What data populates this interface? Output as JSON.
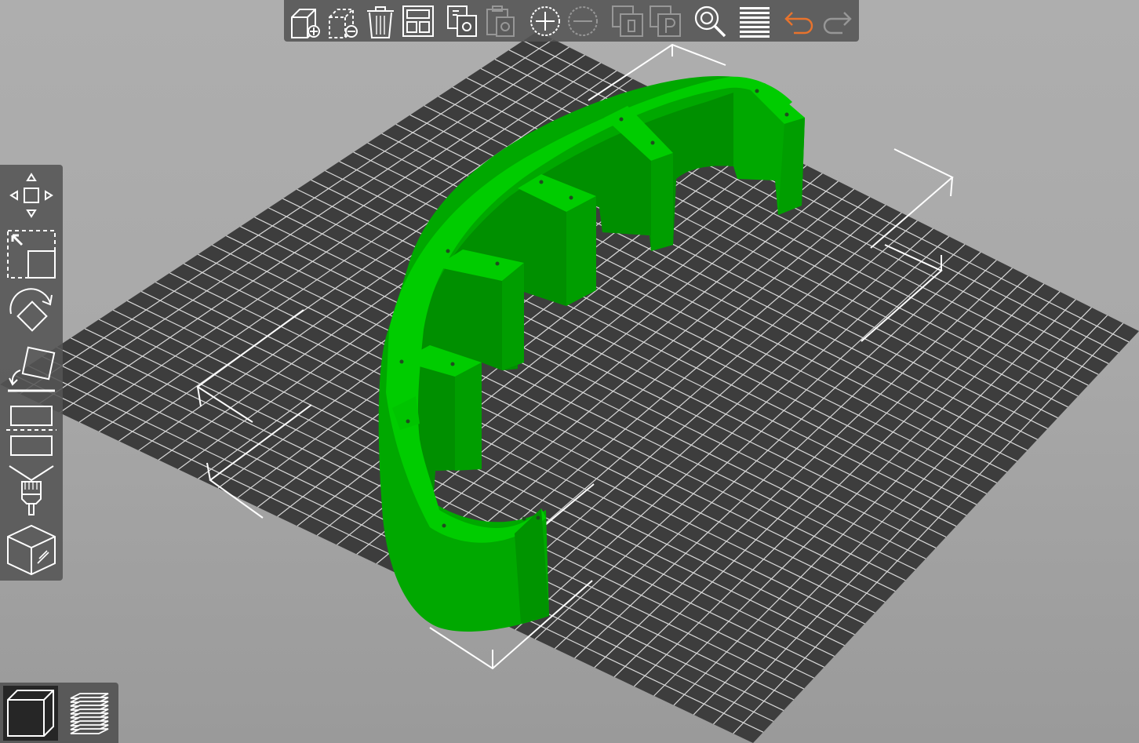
{
  "app": {
    "window": "3D plater view"
  },
  "colors": {
    "model_green": "#00c400",
    "model_green_dark": "#009a00",
    "bed_dark": "#3d3d3d",
    "grid_line": "#d8d8d8",
    "toolbar_bg": "#545454",
    "icon_white": "#ffffff",
    "undo_orange": "#e8732d"
  },
  "top_toolbar": {
    "buttons": [
      {
        "id": "add",
        "icon": "add-object-icon",
        "enabled": true
      },
      {
        "id": "delete",
        "icon": "delete-object-icon",
        "enabled": true
      },
      {
        "id": "delete-all",
        "icon": "delete-all-icon",
        "enabled": true
      },
      {
        "id": "arrange",
        "icon": "arrange-icon",
        "enabled": true
      },
      {
        "id": "copy",
        "icon": "copy-icon",
        "enabled": true
      },
      {
        "id": "paste",
        "icon": "paste-icon",
        "enabled": false
      },
      {
        "id": "add-instance",
        "icon": "add-instance-icon",
        "enabled": true
      },
      {
        "id": "remove-instance",
        "icon": "remove-instance-icon",
        "enabled": false
      },
      {
        "id": "split-objects",
        "icon": "split-objects-icon",
        "enabled": false
      },
      {
        "id": "split-parts",
        "icon": "split-parts-icon",
        "enabled": false
      },
      {
        "id": "search",
        "icon": "search-icon",
        "enabled": true
      },
      {
        "id": "layers-editing",
        "icon": "layers-icon",
        "enabled": true
      },
      {
        "id": "undo",
        "icon": "undo-icon",
        "enabled": true
      },
      {
        "id": "redo",
        "icon": "redo-icon",
        "enabled": false
      }
    ]
  },
  "left_toolbar": {
    "tools": [
      {
        "id": "move",
        "icon": "move-tool-icon"
      },
      {
        "id": "scale",
        "icon": "scale-tool-icon"
      },
      {
        "id": "rotate",
        "icon": "rotate-tool-icon"
      },
      {
        "id": "place-on-face",
        "icon": "place-on-face-icon"
      },
      {
        "id": "cut",
        "icon": "cut-tool-icon"
      },
      {
        "id": "paint-supports",
        "icon": "paint-supports-icon"
      },
      {
        "id": "seam-painting",
        "icon": "seam-painting-icon"
      }
    ]
  },
  "view_toolbar": {
    "buttons": [
      {
        "id": "3d-view",
        "icon": "3d-view-icon",
        "active": true
      },
      {
        "id": "preview",
        "icon": "preview-layers-icon",
        "active": false
      }
    ]
  }
}
